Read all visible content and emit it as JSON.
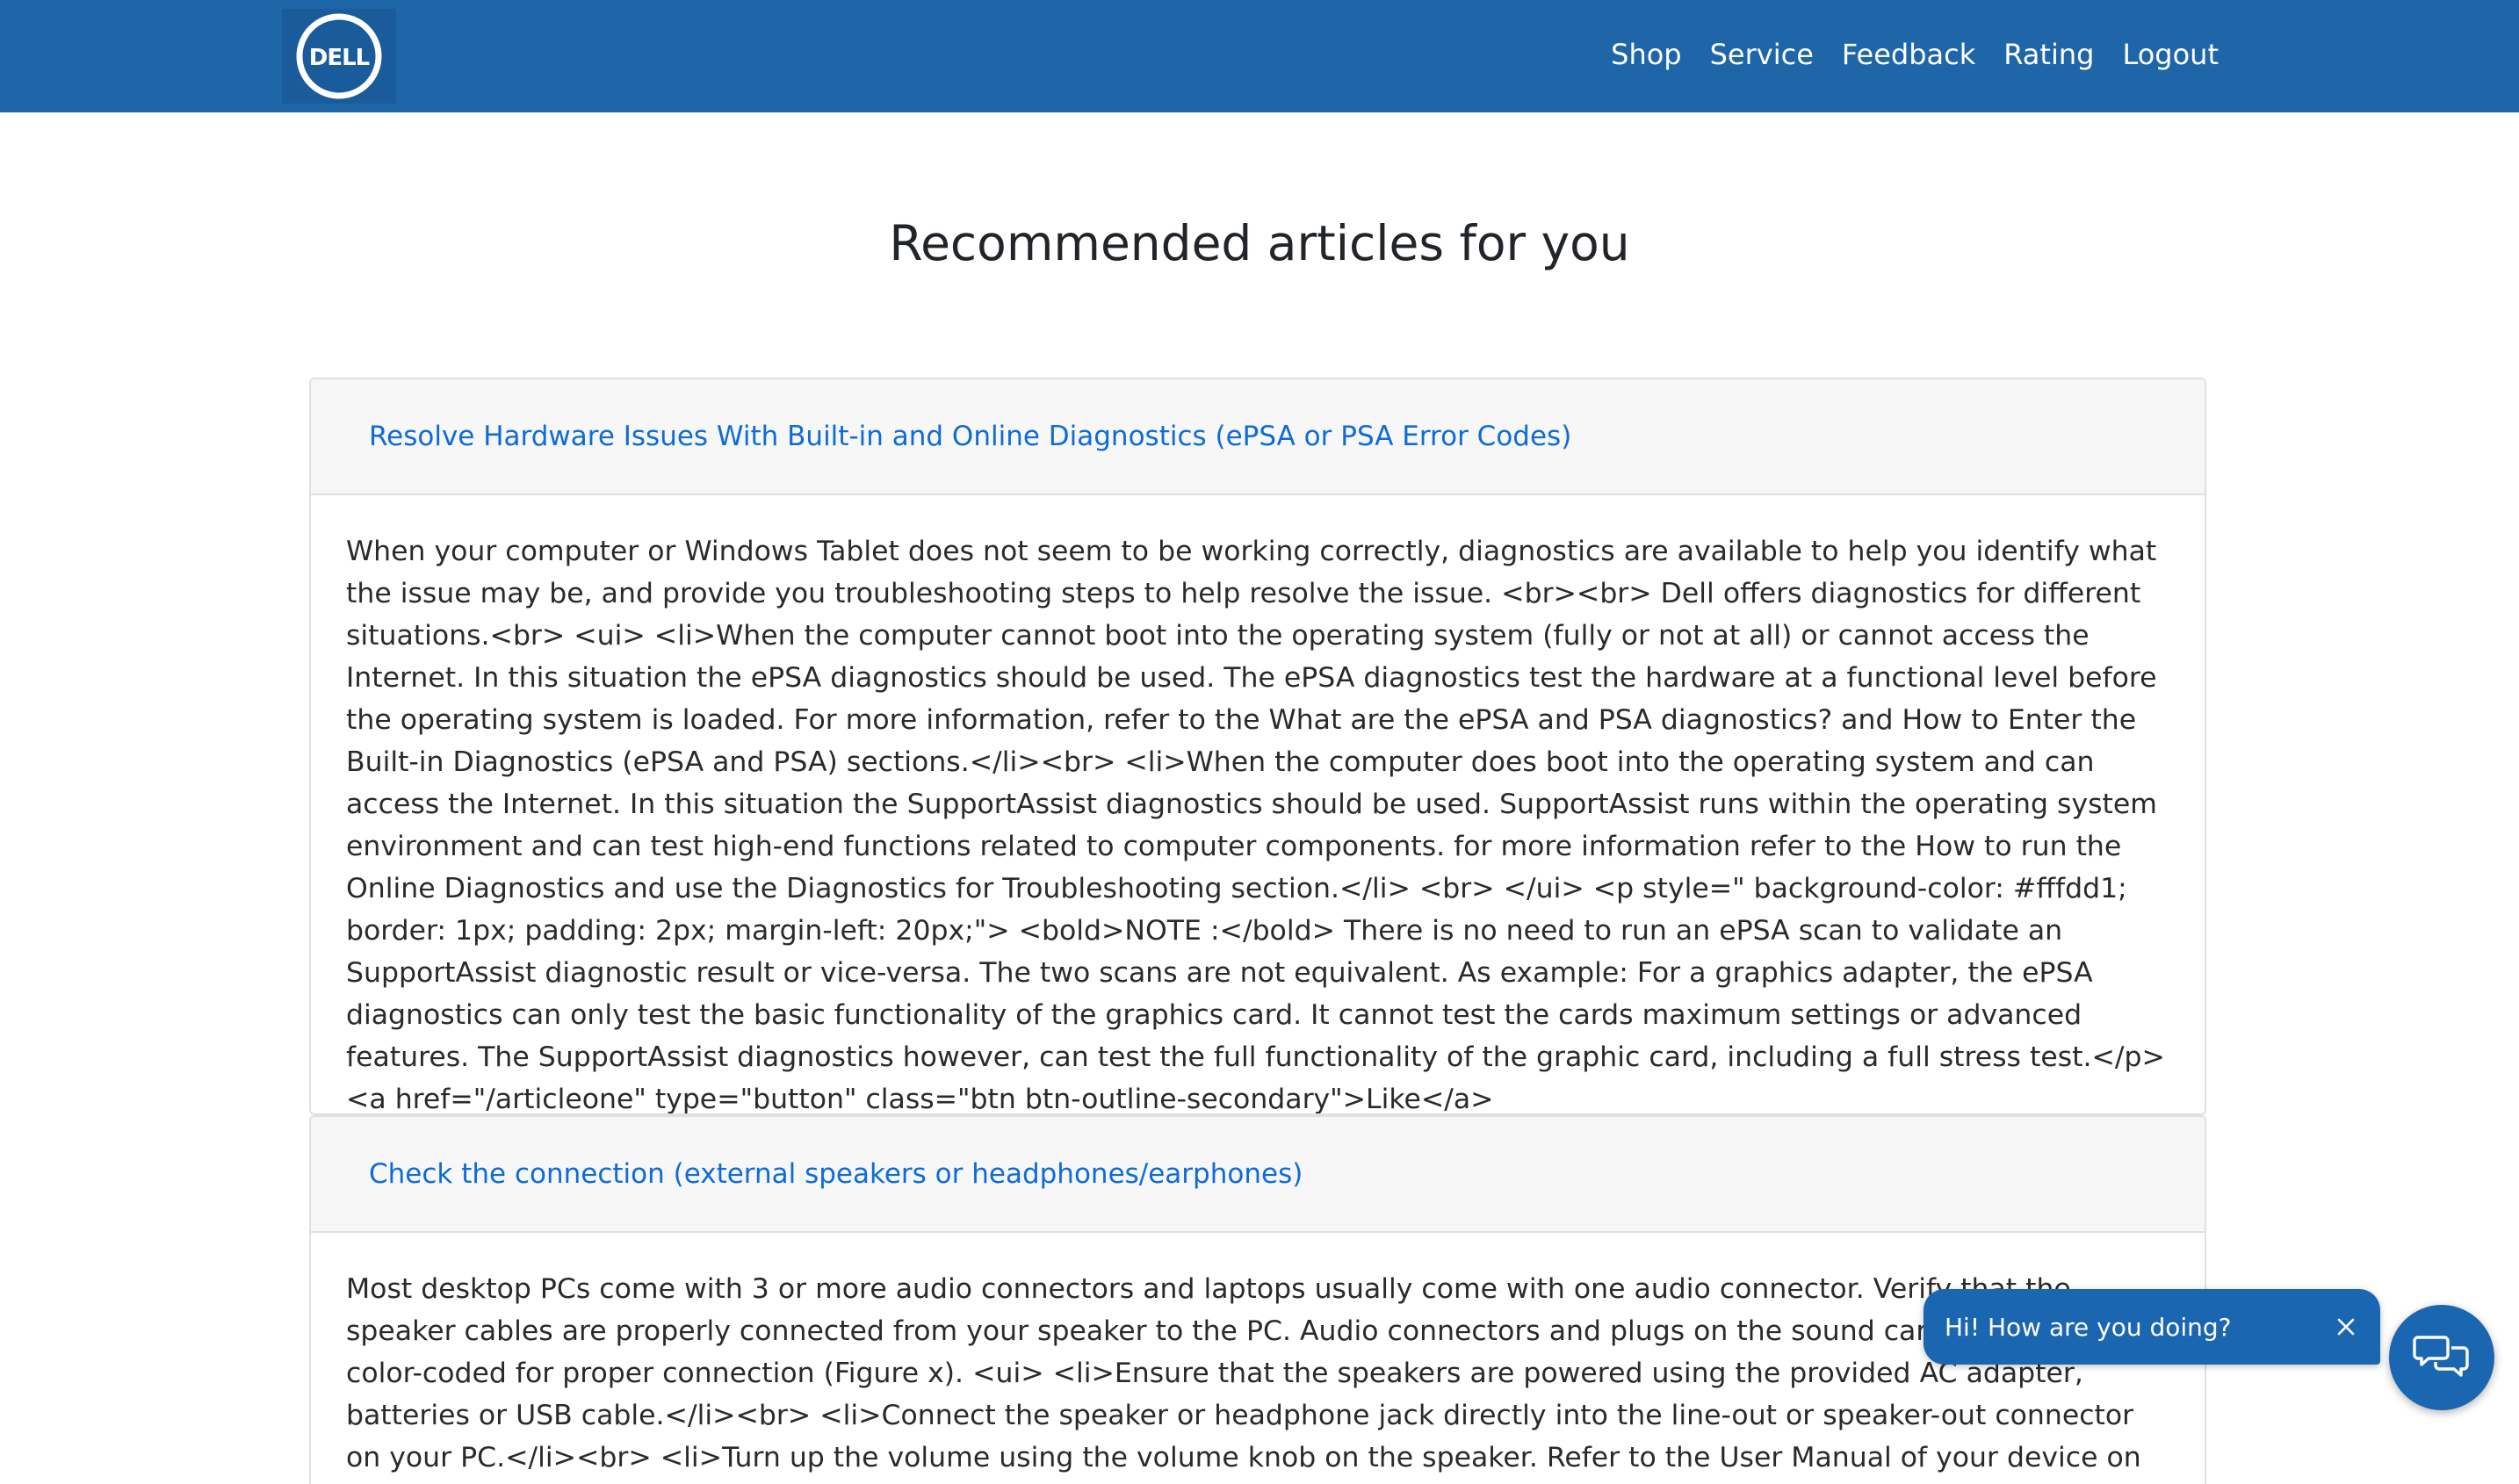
{
  "brand": {
    "logo_text": "DELL",
    "navbar_color": "#1e66a8"
  },
  "nav": {
    "links": [
      "Shop",
      "Service",
      "Feedback",
      "Rating",
      "Logout"
    ]
  },
  "main": {
    "title": "Recommended articles for you",
    "articles": [
      {
        "title": "Resolve Hardware Issues With Built-in and Online Diagnostics (ePSA or PSA Error Codes)",
        "body": "When your computer or Windows Tablet does not seem to be working correctly, diagnostics are available to help you identify what the issue may be, and provide you troubleshooting steps to help resolve the issue. <br><br> Dell offers diagnostics for different situations.<br> <ui> <li>When the computer cannot boot into the operating system (fully or not at all) or cannot access the Internet. In this situation the ePSA diagnostics should be used. The ePSA diagnostics test the hardware at a functional level before the operating system is loaded. For more information, refer to the What are the ePSA and PSA diagnostics? and How to Enter the Built-in Diagnostics (ePSA and PSA) sections.</li><br> <li>When the computer does boot into the operating system and can access the Internet. In this situation the SupportAssist diagnostics should be used. SupportAssist runs within the operating system environment and can test high-end functions related to computer components. for more information refer to the How to run the Online Diagnostics and use the Diagnostics for Troubleshooting section.</li> <br> </ui> <p style=\" background-color: #fffdd1; border: 1px; padding: 2px; margin-left: 20px;\"> <bold>NOTE :</bold> There is no need to run an ePSA scan to validate an SupportAssist diagnostic result or vice-versa. The two scans are not equivalent. As example: For a graphics adapter, the ePSA diagnostics can only test the basic functionality of the graphics card. It cannot test the cards maximum settings or advanced features. The SupportAssist diagnostics however, can test the full functionality of the graphic card, including a full stress test.</p> <a href=\"/articleone\" type=\"button\" class=\"btn btn-outline-secondary\">Like</a>"
      },
      {
        "title": "Check the connection (external speakers or headphones/earphones)",
        "body": "Most desktop PCs come with 3 or more audio connectors and laptops usually come with one audio connector. Verify that the speaker cables are properly connected from your speaker to the PC. Audio connectors and plugs on the sound card are normally color-coded for proper connection (Figure x). <ui> <li>Ensure that the speakers are powered using the provided AC adapter, batteries or USB cable.</li><br> <li>Connect the speaker or headphone jack directly into the line-out or speaker-out connector on your PC.</li><br> <li>Turn up the volume using the volume knob on the speaker. Refer to the User Manual of your device on how to control the volume. </li><br> <li>Test the sound on"
      }
    ]
  },
  "chat": {
    "greeting": "Hi! How are you doing?",
    "close_icon": "close-icon",
    "launcher_icon": "chat-bubbles-icon",
    "color": "#1b66b1"
  }
}
